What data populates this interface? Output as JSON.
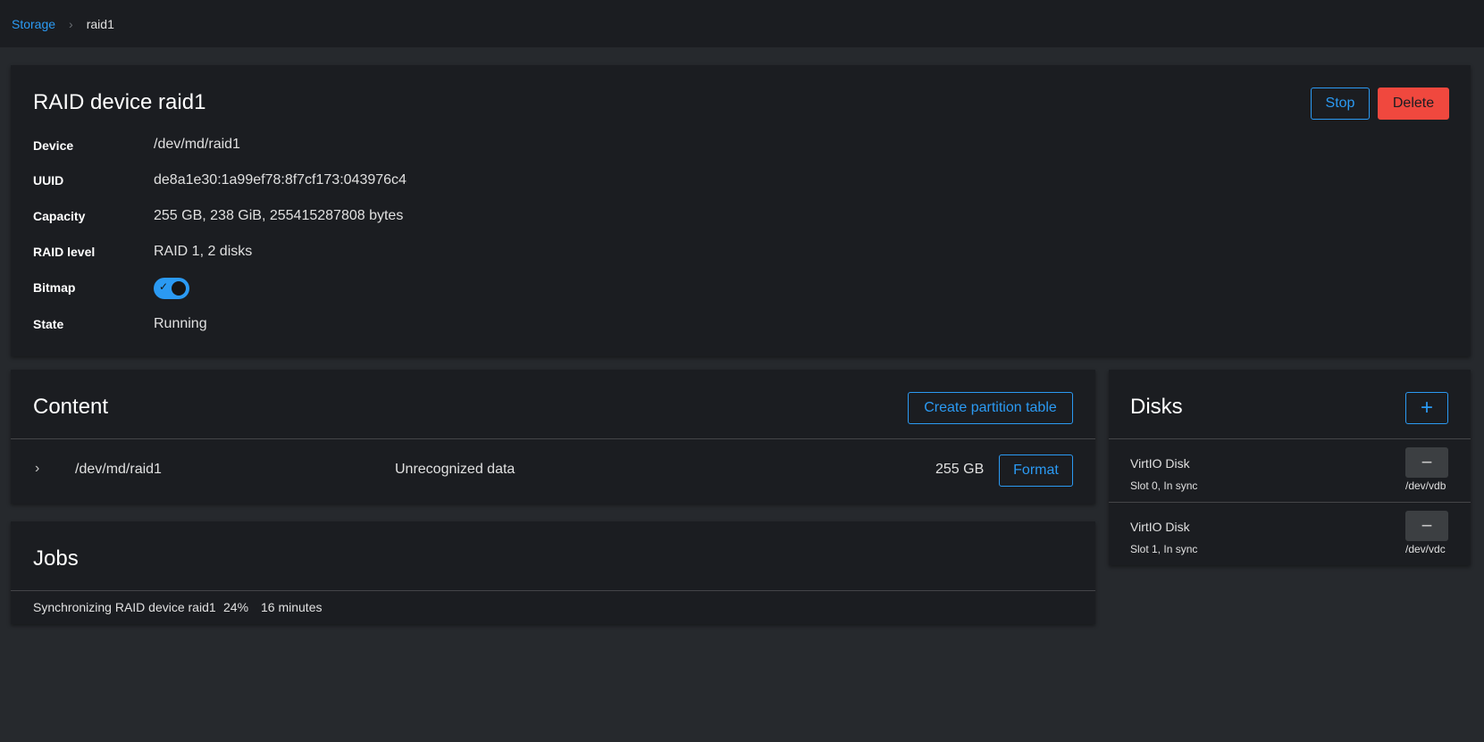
{
  "breadcrumb": {
    "root": "Storage",
    "separator": "›",
    "current": "raid1"
  },
  "device_card": {
    "title": "RAID device raid1",
    "stop_label": "Stop",
    "delete_label": "Delete",
    "properties": [
      {
        "label": "Device",
        "value": "/dev/md/raid1"
      },
      {
        "label": "UUID",
        "value": "de8a1e30:1a99ef78:8f7cf173:043976c4"
      },
      {
        "label": "Capacity",
        "value": "255 GB, 238 GiB, 255415287808 bytes"
      },
      {
        "label": "RAID level",
        "value": "RAID 1, 2 disks"
      },
      {
        "label": "Bitmap",
        "value": "",
        "toggle_on": true
      },
      {
        "label": "State",
        "value": "Running"
      }
    ]
  },
  "content_card": {
    "title": "Content",
    "create_partition_label": "Create partition table",
    "row": {
      "name": "/dev/md/raid1",
      "type": "Unrecognized data",
      "size": "255 GB",
      "format_label": "Format"
    }
  },
  "jobs_card": {
    "title": "Jobs",
    "job": {
      "description": "Synchronizing RAID device raid1",
      "progress": "24%",
      "remaining": "16 minutes"
    }
  },
  "disks_card": {
    "title": "Disks",
    "add_label": "+",
    "disks": [
      {
        "name": "VirtIO Disk",
        "slot": "Slot 0, In sync",
        "path": "/dev/vdb",
        "remove_label": "−"
      },
      {
        "name": "VirtIO Disk",
        "slot": "Slot 1, In sync",
        "path": "/dev/vdc",
        "remove_label": "−"
      }
    ]
  },
  "colors": {
    "accent": "#2b9af3",
    "danger": "#f0483e",
    "card_bg": "#1b1d21",
    "page_bg": "#26292d"
  }
}
